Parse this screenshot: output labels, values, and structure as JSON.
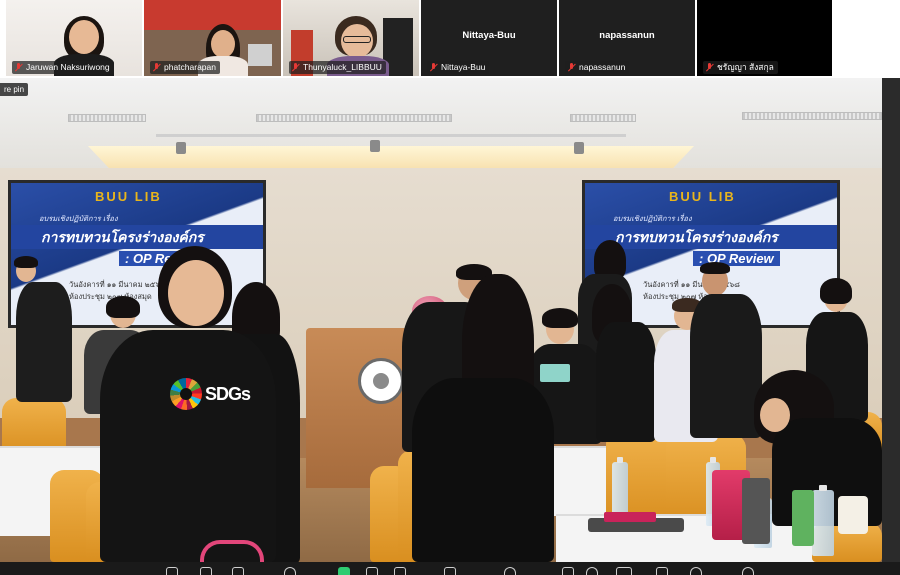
{
  "participants": [
    {
      "name": "Jaruwan Naksuriwong",
      "muted": true,
      "video": true
    },
    {
      "name": "phatcharapan",
      "muted": true,
      "video": true
    },
    {
      "name": "Thunyaluck_LIBBUU",
      "muted": true,
      "video": true
    },
    {
      "name": "Nittaya-Buu",
      "muted": true,
      "video": false
    },
    {
      "name": "napassanun",
      "muted": true,
      "video": false
    },
    {
      "name": "ชรัญญา สังสกุล",
      "muted": true,
      "video": true
    }
  ],
  "main_video": {
    "pin_label": "re pin",
    "slide": {
      "logo": "BUU LIB",
      "subtitle": "อบรมเชิงปฏิบัติการ เรื่อง",
      "title_th": "การทบทวนโครงร่างองค์กร",
      "title_en": ": OP Review",
      "date_line": "วันอังคารที่ ๑๑ มีนาคม ๒๕๖๘",
      "venue_line": "ห้องประชุม ๒๐๗ ห้องสมุด"
    },
    "shirt_text": "SDGs"
  },
  "colors": {
    "mic_muted": "#e53935",
    "slide_blue": "#2345a0",
    "chair_orange": "#e9a232"
  },
  "toolbar": {
    "icons": [
      "audio-icon",
      "video-icon",
      "participants-icon",
      "chat-icon",
      "share-screen-icon",
      "record-icon",
      "reactions-icon",
      "apps-icon",
      "whiteboard-icon",
      "more-icon",
      "info-icon",
      "view-icon",
      "layout-icon",
      "globe-icon",
      "caption-icon"
    ]
  }
}
